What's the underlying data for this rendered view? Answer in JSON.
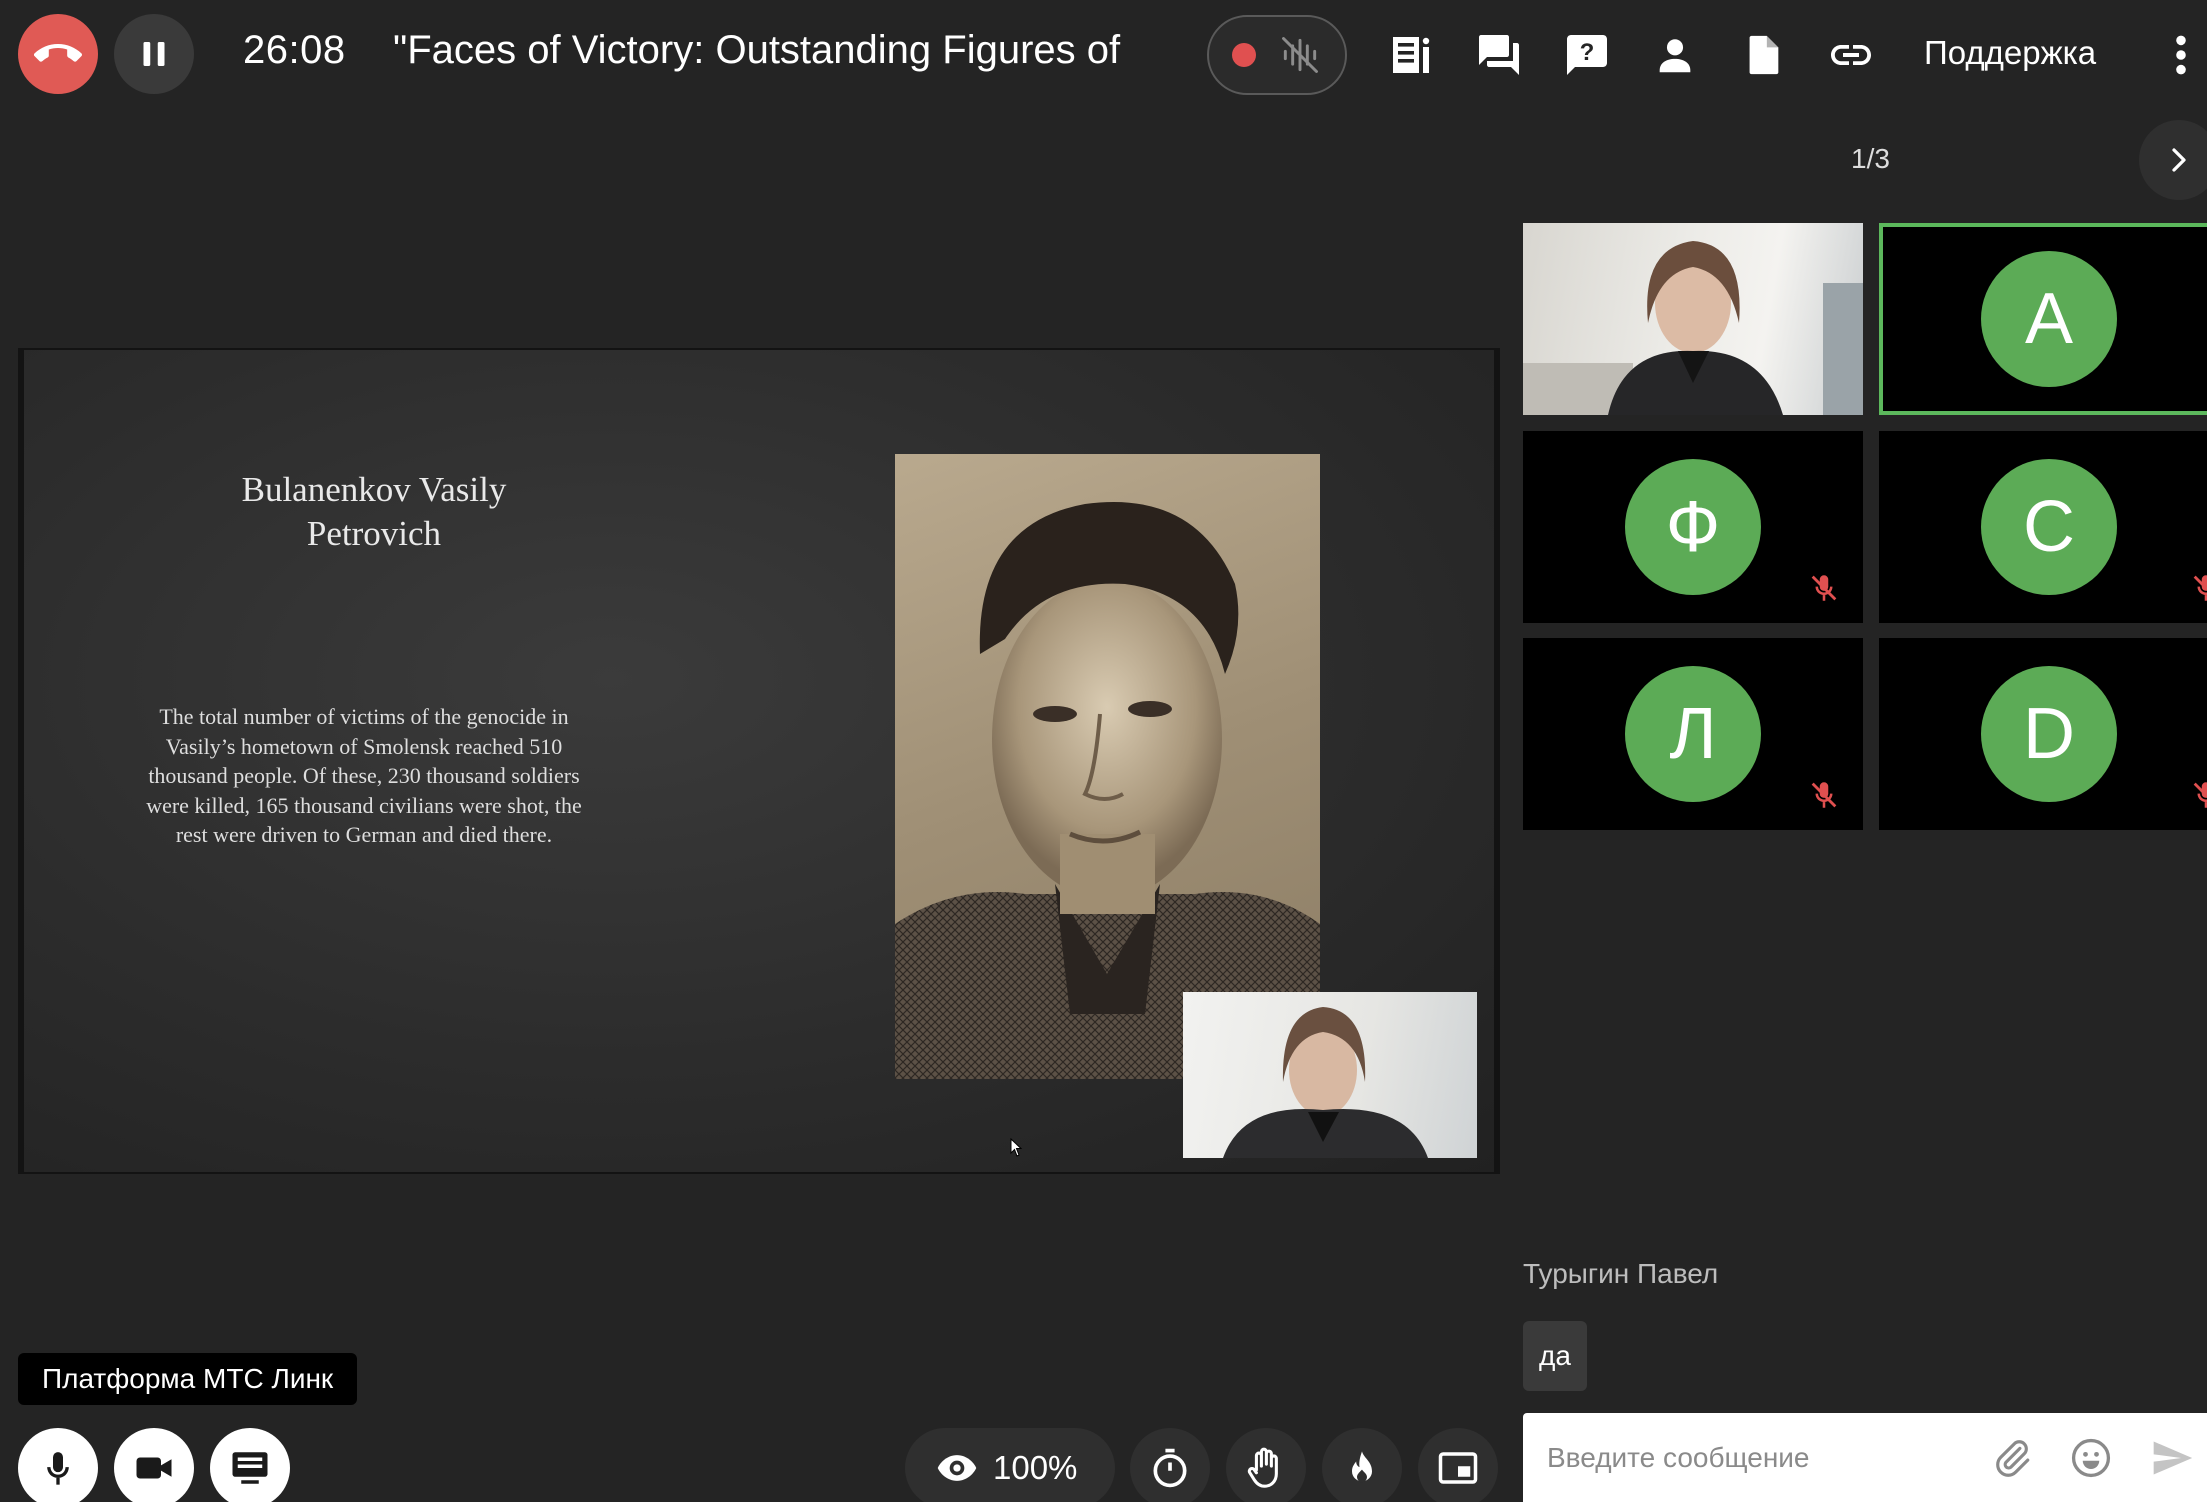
{
  "header": {
    "timer": "26:08",
    "title": "\"Faces of Victory: Outstanding Figures of",
    "support_label": "Поддержка",
    "icons": [
      "hangup-icon",
      "pause-icon",
      "record-icon",
      "noise-cancel-icon",
      "agenda-icon",
      "chat-icon",
      "question-icon",
      "participants-icon",
      "file-icon",
      "link-icon",
      "more-icon"
    ]
  },
  "slide": {
    "heading": "Bulanenkov Vasily Petrovich",
    "body": "The total number of victims of the genocide in Vasily’s hometown of Smolensk reached 510 thousand people. Of these, 230 thousand soldiers were killed, 165 thousand civilians were shot, the rest were driven to German and died there."
  },
  "participants": {
    "pager": "1/3",
    "tiles": [
      {
        "type": "video"
      },
      {
        "type": "avatar",
        "letter": "А",
        "active": true
      },
      {
        "type": "avatar",
        "letter": "Ф",
        "muted": true
      },
      {
        "type": "avatar",
        "letter": "С",
        "muted": true
      },
      {
        "type": "avatar",
        "letter": "Л",
        "muted": true
      },
      {
        "type": "avatar",
        "letter": "D",
        "muted": true
      }
    ]
  },
  "chat": {
    "author": "Турыгин Павел",
    "message": "да",
    "input_placeholder": "Введите сообщение"
  },
  "footer": {
    "platform_label": "Платформа МТС Линк",
    "zoom": "100%"
  },
  "colors": {
    "background": "#242424",
    "hangup": "#e05a55",
    "avatar": "#5cab56",
    "active_border": "#5cb85c",
    "muted": "#e05050"
  }
}
